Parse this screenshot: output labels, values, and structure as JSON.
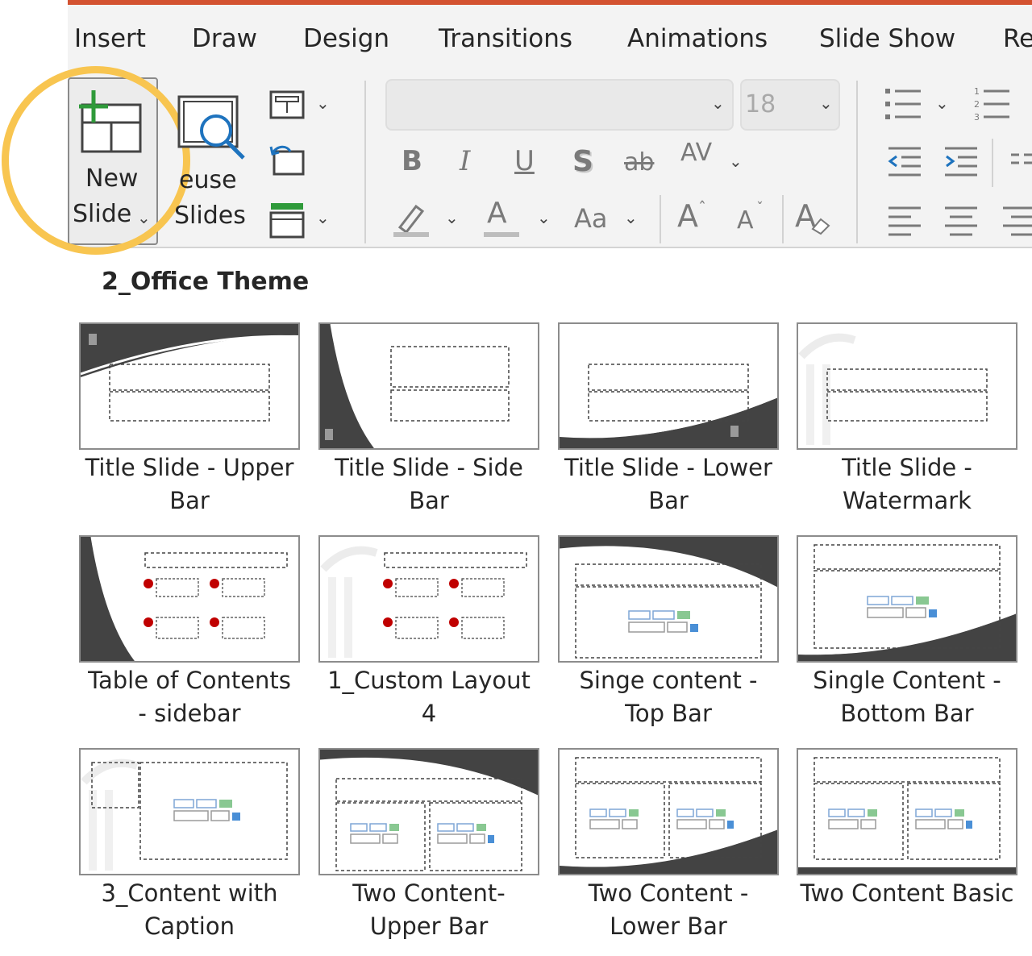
{
  "tabs": [
    "Insert",
    "Draw",
    "Design",
    "Transitions",
    "Animations",
    "Slide Show",
    "Re"
  ],
  "new_slide": {
    "line1": "New",
    "line2": "Slide"
  },
  "reuse_slides": {
    "line1": "euse",
    "line2": "Slides"
  },
  "font_size": "18",
  "format_buttons": {
    "bold": "B",
    "italic": "I",
    "underline": "U",
    "shadow": "S",
    "strike": "ab",
    "spacing": "AV",
    "font_color": "A",
    "change_case": "Aa",
    "grow": "A",
    "shrink": "A",
    "clear": "A"
  },
  "section_title": "2_Office Theme",
  "layouts": [
    {
      "line1": "Title Slide - Upper",
      "line2": "Bar"
    },
    {
      "line1": "Title Slide - Side",
      "line2": "Bar"
    },
    {
      "line1": "Title Slide - Lower",
      "line2": "Bar"
    },
    {
      "line1": "Title Slide -",
      "line2": "Watermark"
    },
    {
      "line1": "Table of Contents",
      "line2": "- sidebar"
    },
    {
      "line1": "1_Custom Layout",
      "line2": "4"
    },
    {
      "line1": "Singe content -",
      "line2": "Top Bar"
    },
    {
      "line1": "Single Content -",
      "line2": "Bottom Bar"
    },
    {
      "line1": "3_Content with",
      "line2": "Caption"
    },
    {
      "line1": "Two Content-",
      "line2": "Upper Bar"
    },
    {
      "line1": "Two Content -",
      "line2": "Lower Bar"
    },
    {
      "line1": "Two Content Basic",
      "line2": ""
    }
  ],
  "colors": {
    "accent": "#d35230",
    "highlight": "#f8c550",
    "ribbon": "#f3f3f3",
    "slide_dark": "#434343",
    "marker": "#c00000"
  }
}
